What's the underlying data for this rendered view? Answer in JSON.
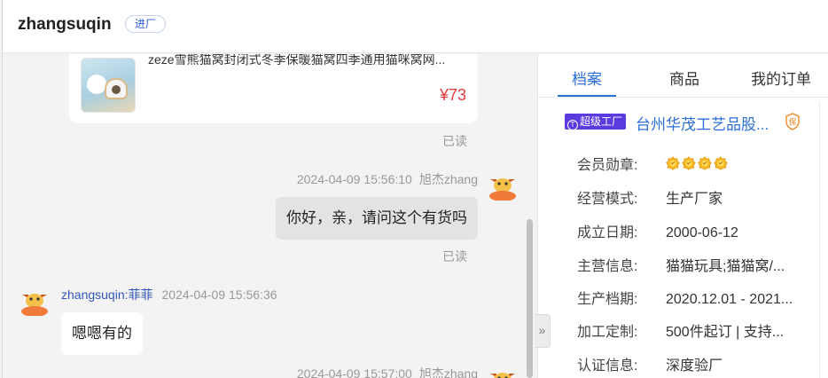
{
  "header": {
    "username": "zhangsuqin",
    "badge": "进厂"
  },
  "chat": {
    "product": {
      "title": "zeze雪熊猫窝封闭式冬季保暖猫窝四季通用猫咪窝网...",
      "price": "¥73"
    },
    "messages": [
      {
        "type": "read",
        "text": "已读"
      },
      {
        "type": "outgoing",
        "time": "2024-04-09 15:56:10",
        "sender": "旭杰zhang",
        "text": "你好，亲，请问这个有货吗",
        "status": "已读"
      },
      {
        "type": "incoming",
        "sender": "zhangsuqin:菲菲",
        "time": "2024-04-09 15:56:36",
        "text": "嗯嗯有的"
      },
      {
        "type": "outgoing",
        "time": "2024-04-09 15:57:00",
        "sender": "旭杰zhang"
      }
    ],
    "toggle_icon": "»"
  },
  "panel": {
    "tabs": [
      {
        "label": "档案",
        "active": true
      },
      {
        "label": "商品",
        "active": false
      },
      {
        "label": "我的订单",
        "active": false
      }
    ],
    "factory_tag": "超级工厂",
    "company": "台州华茂工艺品股...",
    "shield_icon": "保",
    "rows": [
      {
        "label": "会员勋章:",
        "value": ""
      },
      {
        "label": "经营模式:",
        "value": "生产厂家"
      },
      {
        "label": "成立日期:",
        "value": "2000-06-12"
      },
      {
        "label": "主营信息:",
        "value": "猫猫玩具;猫猫窝/..."
      },
      {
        "label": "生产档期:",
        "value": "2020.12.01 - 2021..."
      },
      {
        "label": "加工定制:",
        "value": "500件起订 | 支持..."
      },
      {
        "label": "认证信息:",
        "value": "深度验厂"
      }
    ],
    "medal_count": 4
  },
  "colors": {
    "accent": "#2d6fd6",
    "price": "#e4393c",
    "factory_tag": "#5b3ae0",
    "avatar": "#f07a3a"
  }
}
